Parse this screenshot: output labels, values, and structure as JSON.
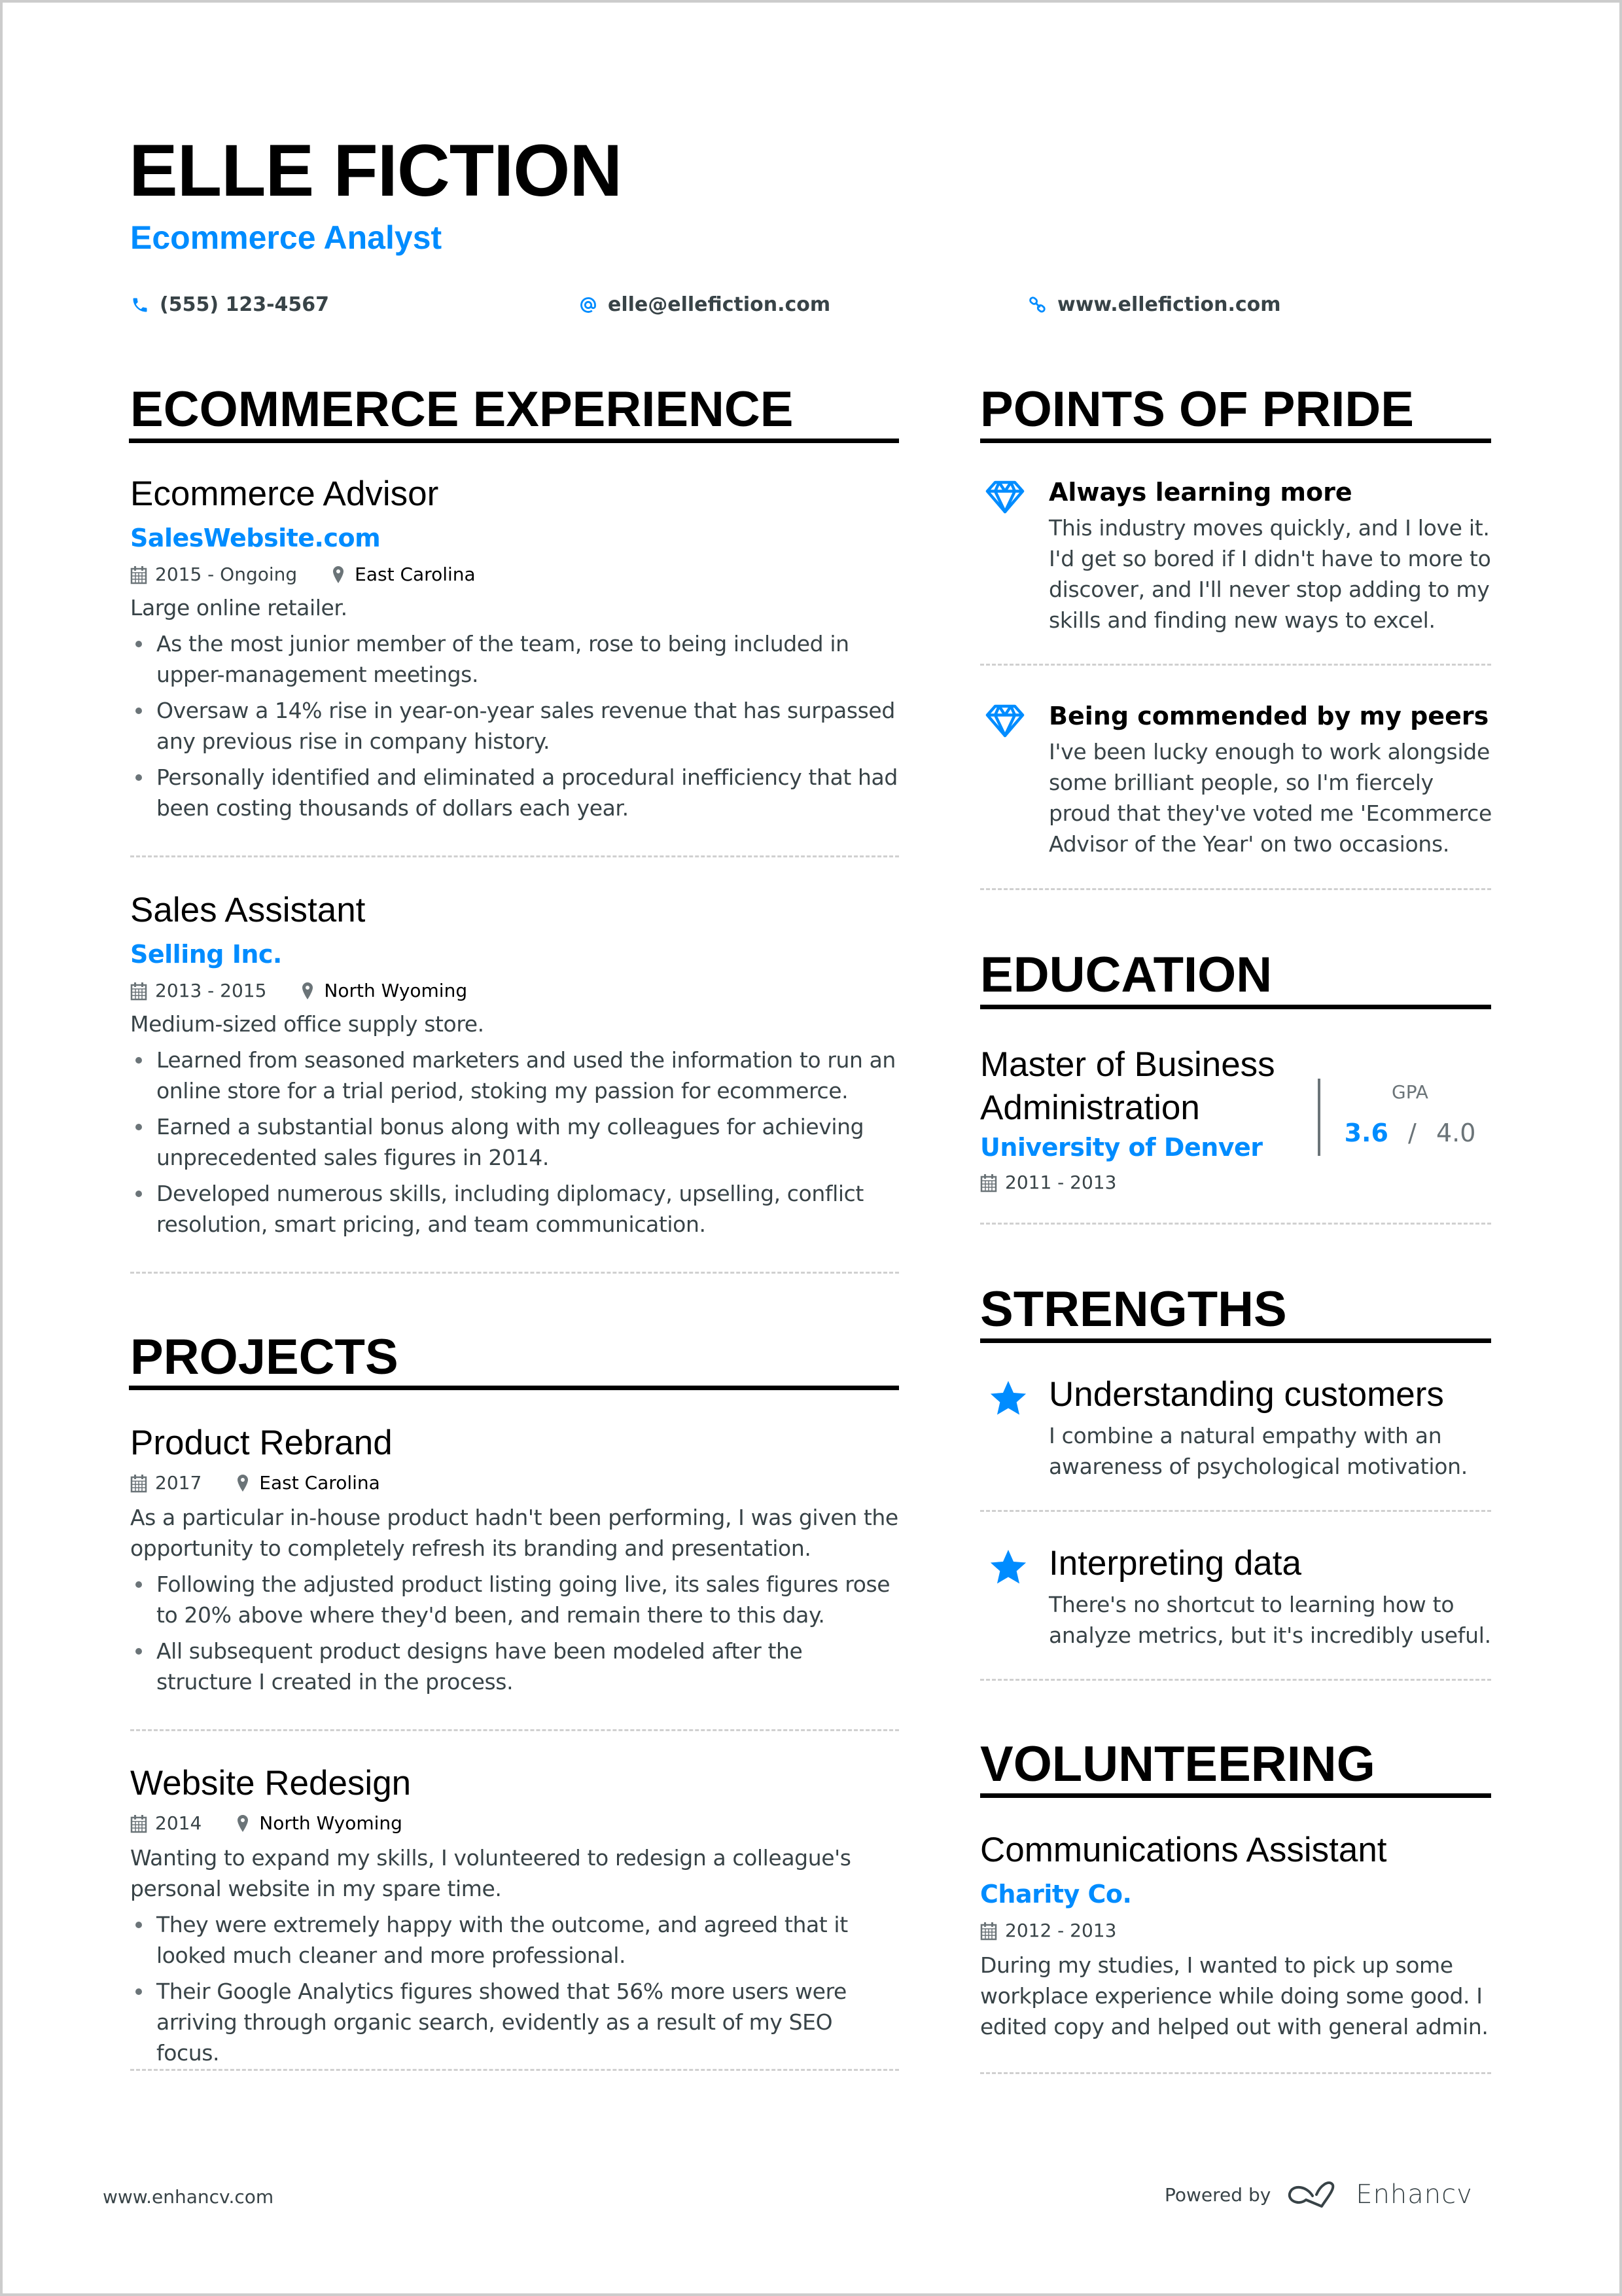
{
  "header": {
    "name": "ELLE FICTION",
    "role": "Ecommerce Analyst",
    "contacts": [
      {
        "icon": "phone-icon",
        "text": "(555) 123-4567"
      },
      {
        "icon": "at-icon",
        "text": "elle@ellefiction.com"
      },
      {
        "icon": "link-icon",
        "text": "www.ellefiction.com"
      }
    ]
  },
  "colors": {
    "accent": "#008cff",
    "text": "#384347",
    "heading": "#000000",
    "border": "#cccccc"
  },
  "experience": {
    "title": "ECOMMERCE EXPERIENCE",
    "entries": [
      {
        "title": "Ecommerce Advisor",
        "company": "SalesWebsite.com",
        "dates": "2015 - Ongoing",
        "location": "East Carolina",
        "description": "Large online retailer.",
        "bullets": [
          "As the most junior member of the team, rose to being included in upper-management meetings.",
          "Oversaw a 14% rise in year-on-year sales revenue that has surpassed any previous rise in company history.",
          "Personally identified and eliminated a procedural inefficiency that had been costing thousands of dollars each year."
        ]
      },
      {
        "title": "Sales Assistant",
        "company": "Selling Inc.",
        "dates": "2013 - 2015",
        "location": "North Wyoming",
        "description": "Medium-sized office supply store.",
        "bullets": [
          "Learned from seasoned marketers and used the information to run an online store for a trial period, stoking my passion for ecommerce.",
          "Earned a substantial bonus along with my colleagues for achieving unprecedented sales figures in 2014.",
          "Developed numerous skills, including diplomacy, upselling, conflict resolution, smart pricing, and team communication."
        ]
      }
    ]
  },
  "projects": {
    "title": "PROJECTS",
    "entries": [
      {
        "title": "Product Rebrand",
        "dates": "2017",
        "location": "East Carolina",
        "description": "As a particular in-house product hadn't been performing, I was given the opportunity to completely refresh its branding and presentation.",
        "bullets": [
          "Following the adjusted product listing going live, its sales figures rose to 20% above where they'd been, and remain there to this day.",
          "All subsequent product designs have been modeled after the structure I created in the process."
        ]
      },
      {
        "title": "Website Redesign",
        "dates": "2014",
        "location": "North Wyoming",
        "description": "Wanting to expand my skills, I volunteered to redesign a colleague's personal website in my spare time.",
        "bullets": [
          "They were extremely happy with the outcome, and agreed that it looked much cleaner and more professional.",
          "Their Google Analytics figures showed that 56% more users were arriving through organic search, evidently as a result of my SEO focus."
        ]
      }
    ]
  },
  "pride": {
    "title": "POINTS OF PRIDE",
    "items": [
      {
        "icon": "diamond-icon",
        "title": "Always learning more",
        "description": "This industry moves quickly, and I love it. I'd get so bored if I didn't have to more to discover, and I'll never stop adding to my skills and finding new ways to excel."
      },
      {
        "icon": "diamond-icon",
        "title": "Being commended by my peers",
        "description": "I've been lucky enough to work alongside some brilliant people, so I'm fiercely proud that they've voted me 'Ecommerce Advisor of the Year' on two occasions."
      }
    ]
  },
  "education": {
    "title": "EDUCATION",
    "degree": "Master of Business Administration",
    "school": "University of Denver",
    "dates": "2011 - 2013",
    "gpa_label": "GPA",
    "gpa": "3.6",
    "gpa_separator": "/",
    "gpa_max": "4.0"
  },
  "strengths": {
    "title": "STRENGTHS",
    "items": [
      {
        "icon": "star-icon",
        "title": "Understanding customers",
        "description": "I combine a natural empathy with an awareness of psychological motivation."
      },
      {
        "icon": "star-icon",
        "title": "Interpreting data",
        "description": "There's no shortcut to learning how to analyze metrics, but it's incredibly useful."
      }
    ]
  },
  "volunteering": {
    "title": "VOLUNTEERING",
    "entries": [
      {
        "title": "Communications Assistant",
        "company": "Charity Co.",
        "dates": "2012 - 2013",
        "description": "During my studies, I wanted to pick up some workplace experience while doing some good. I edited copy and helped out with general admin."
      }
    ]
  },
  "footer": {
    "site": "www.enhancv.com",
    "powered_by": "Powered by",
    "brand": "Enhancv"
  }
}
